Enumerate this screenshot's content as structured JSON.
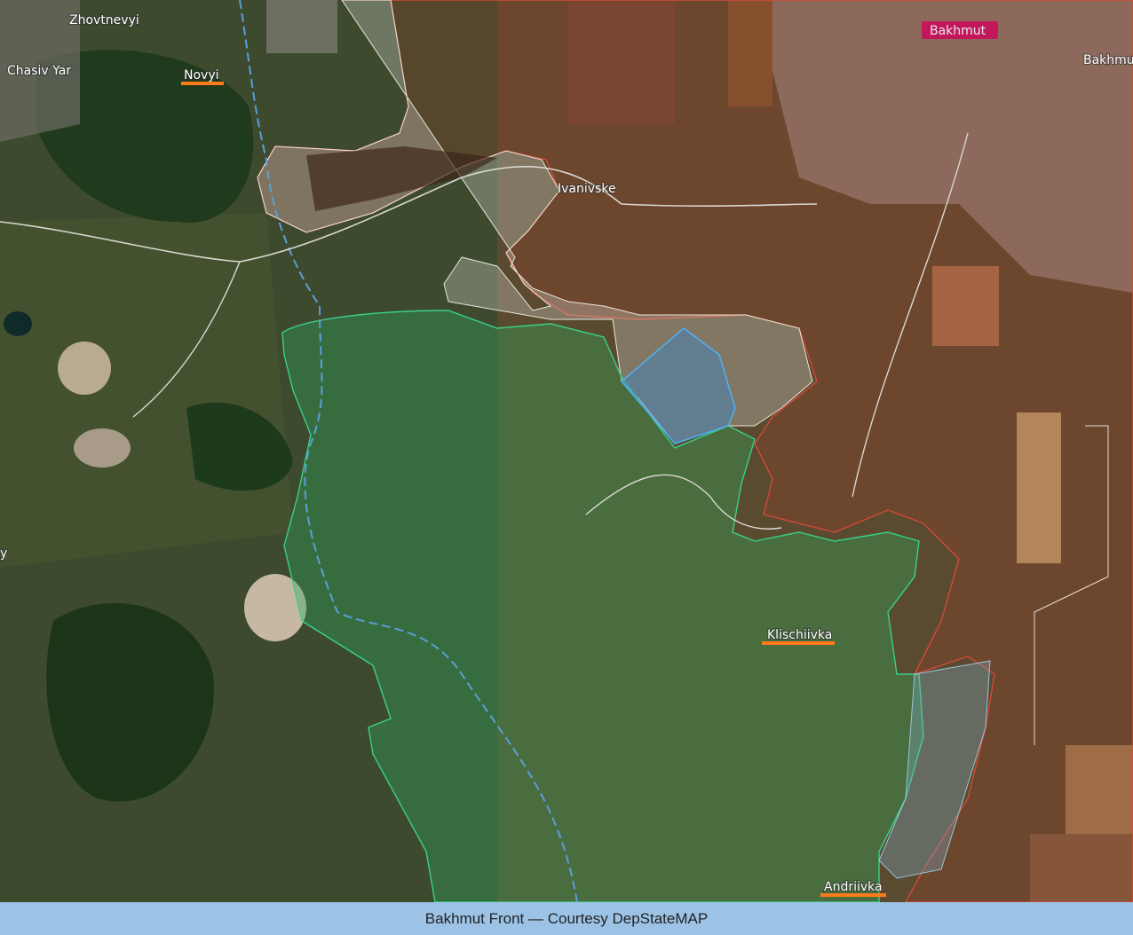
{
  "map": {
    "places": {
      "zhovtnevyi": "Zhovtnevyi",
      "chasiv_yar": "Chasiv Yar",
      "novyi": "Novyi",
      "ivanivske": "Ivanivske",
      "bakhmut_badge": "Bakhmut",
      "bakhmut_edge": "Bakhmut",
      "klischiivka": "Klischiivka",
      "andriivka": "Andriivka",
      "edge_letter": "y"
    },
    "colors": {
      "ukraine_controlled": "#2fa85a",
      "russia_controlled": "#b23a2a",
      "contested": "#c8c8c0",
      "liberated_recent": "#3a86c8",
      "underline": "#ff7a1a",
      "bakhmut_badge": "#c2185b"
    }
  },
  "caption": {
    "text": "Bakhmut Front — Courtesy DepStateMAP"
  }
}
